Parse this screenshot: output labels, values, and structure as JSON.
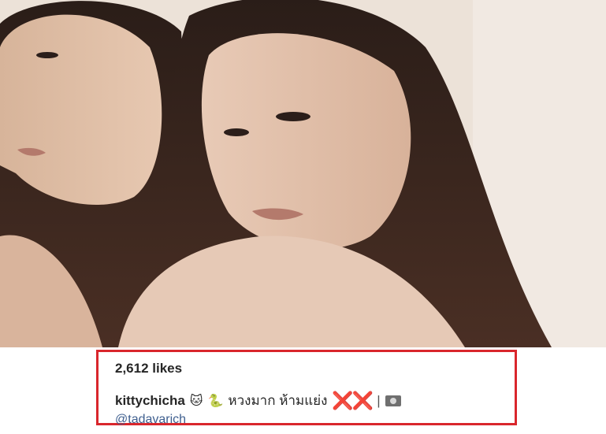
{
  "post": {
    "likes": "2,612 likes",
    "username": "kittychicha",
    "emoji_cat": "🐱",
    "emoji_snake": "🐍",
    "caption_text": "หวงมาก ห้ามแย่ง",
    "x_marks": "❌❌",
    "separator": "|",
    "mention": "@tadavarich"
  },
  "colors": {
    "highlight_border": "#d9262c",
    "mention": "#3f5f8f",
    "text": "#262626"
  },
  "icons": {
    "camera": "camera-icon"
  }
}
